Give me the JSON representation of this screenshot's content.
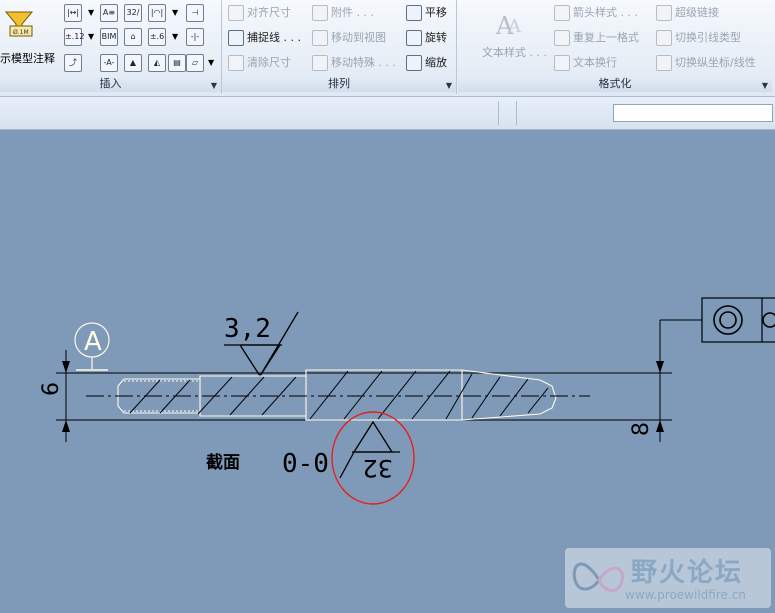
{
  "ribbon": {
    "groups": {
      "insert": "插入",
      "arrange": "排列",
      "format": "格式化"
    },
    "show_annotations": "示模型注释",
    "arrange_cmds": {
      "align_dims": "对齐尺寸",
      "attachment": "附件 . . .",
      "pan": "平移",
      "snap_line": "捕捉线 . . .",
      "move_to_view": "移动到视图",
      "rotate": "旋转",
      "clean_dims": "清除尺寸",
      "move_special": "移动特殊 . . .",
      "zoom": "缩放"
    },
    "format_cmds": {
      "text_style": "文本样式 . . .",
      "arrow_style": "箭头样式 . . .",
      "hyperlink": "超级链接",
      "repeat_format": "重复上一格式",
      "toggle_leader": "切换引线类型",
      "text_wrap": "文本换行",
      "toggle_ordinate": "切换纵坐标/线性"
    },
    "insert_icons": {
      "r1": [
        "|↔|",
        "A≡",
        "32/",
        "|◠|",
        "⊣"
      ],
      "r2": [
        "±.12",
        "BIM",
        "⌂",
        "±.6",
        "-|-"
      ],
      "r3": [
        "⤴",
        "-A-",
        "▲",
        "◭",
        "▤",
        "▱"
      ]
    }
  },
  "drawing": {
    "datum": "A",
    "roughness_top": "3,2",
    "dim_left": "6",
    "dim_right": "8",
    "section_label": "截面",
    "section_name": "0-0",
    "roughness_markup": "32",
    "colors": {
      "background": "#7f99b9",
      "geometry": "#fffbe6",
      "dim_lines": "#000000",
      "markup": "#e32020"
    }
  },
  "watermark": {
    "title": "野火论坛",
    "url": "www.proewildfire.cn"
  }
}
